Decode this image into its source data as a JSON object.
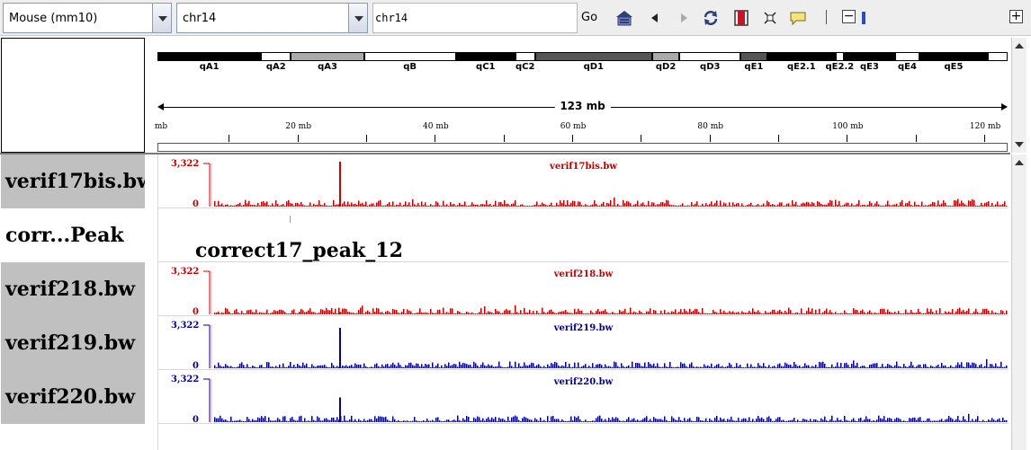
{
  "toolbar": {
    "genome": "Mouse (mm10)",
    "chromosome": "chr14",
    "locus_value": "chr14",
    "go_label": "Go"
  },
  "ideogram": {
    "bands": [
      {
        "name": "qA1",
        "start": 0.0,
        "end": 0.122,
        "color": "#000000"
      },
      {
        "name": "qA2",
        "start": 0.122,
        "end": 0.157,
        "color": "#ffffff"
      },
      {
        "name": "qA3",
        "start": 0.157,
        "end": 0.243,
        "color": "#aaaaaa"
      },
      {
        "name": "qB",
        "start": 0.243,
        "end": 0.351,
        "color": "#ffffff"
      },
      {
        "name": "qC1",
        "start": 0.351,
        "end": 0.421,
        "color": "#000000"
      },
      {
        "name": "qC2",
        "start": 0.421,
        "end": 0.444,
        "color": "#ffffff"
      },
      {
        "name": "qD1",
        "start": 0.444,
        "end": 0.582,
        "color": "#555555"
      },
      {
        "name": "qD2",
        "start": 0.582,
        "end": 0.614,
        "color": "#aaaaaa"
      },
      {
        "name": "qD3",
        "start": 0.614,
        "end": 0.686,
        "color": "#ffffff"
      },
      {
        "name": "qE1",
        "start": 0.686,
        "end": 0.717,
        "color": "#555555"
      },
      {
        "name": "qE2.1",
        "start": 0.717,
        "end": 0.798,
        "color": "#000000"
      },
      {
        "name": "qE2.2",
        "start": 0.798,
        "end": 0.807,
        "color": "#ffffff"
      },
      {
        "name": "qE3",
        "start": 0.807,
        "end": 0.868,
        "color": "#000000"
      },
      {
        "name": "qE4",
        "start": 0.868,
        "end": 0.896,
        "color": "#ffffff"
      },
      {
        "name": "qE5",
        "start": 0.896,
        "end": 0.977,
        "color": "#000000"
      },
      {
        "name": "",
        "start": 0.977,
        "end": 1.0,
        "color": "#ffffff"
      }
    ],
    "band_labels": [
      "qA1",
      "qA2",
      "qA3",
      "qB",
      "qC1",
      "qC2",
      "qD1",
      "qD2",
      "qD3",
      "qE1",
      "qE2.1",
      "qE2.2",
      "qE3",
      "qE4",
      "qE5"
    ]
  },
  "ruler": {
    "span_label": "123 mb",
    "chrom_length_mb": 123,
    "tick_labels": [
      {
        "text": "mb",
        "mb": 0
      },
      {
        "text": "20 mb",
        "mb": 20
      },
      {
        "text": "40 mb",
        "mb": 40
      },
      {
        "text": "60 mb",
        "mb": 60
      },
      {
        "text": "80 mb",
        "mb": 80
      },
      {
        "text": "100 mb",
        "mb": 100
      },
      {
        "text": "120 mb",
        "mb": 120
      }
    ]
  },
  "tracks": [
    {
      "name": "verif17bis.bw",
      "title": "verif17bis.bw",
      "max": "3,322",
      "min": "0",
      "color": "#c00000",
      "peak_mb": 19.4,
      "peak_frac": 1.0
    },
    {
      "name": "corr...Peak",
      "peak_label": "correct17_peak_12"
    },
    {
      "name": "verif218.bw",
      "title": "verif218.bw",
      "max": "3,322",
      "min": "0",
      "color": "#c00000",
      "peak_mb": 19.4,
      "peak_frac": 0.05
    },
    {
      "name": "verif219.bw",
      "title": "verif219.bw",
      "max": "3,322",
      "min": "0",
      "color": "#00008b",
      "peak_mb": 19.4,
      "peak_frac": 0.9
    },
    {
      "name": "verif220.bw",
      "title": "verif220.bw",
      "max": "3,322",
      "min": "0",
      "color": "#00008b",
      "peak_mb": 19.4,
      "peak_frac": 0.55
    }
  ]
}
